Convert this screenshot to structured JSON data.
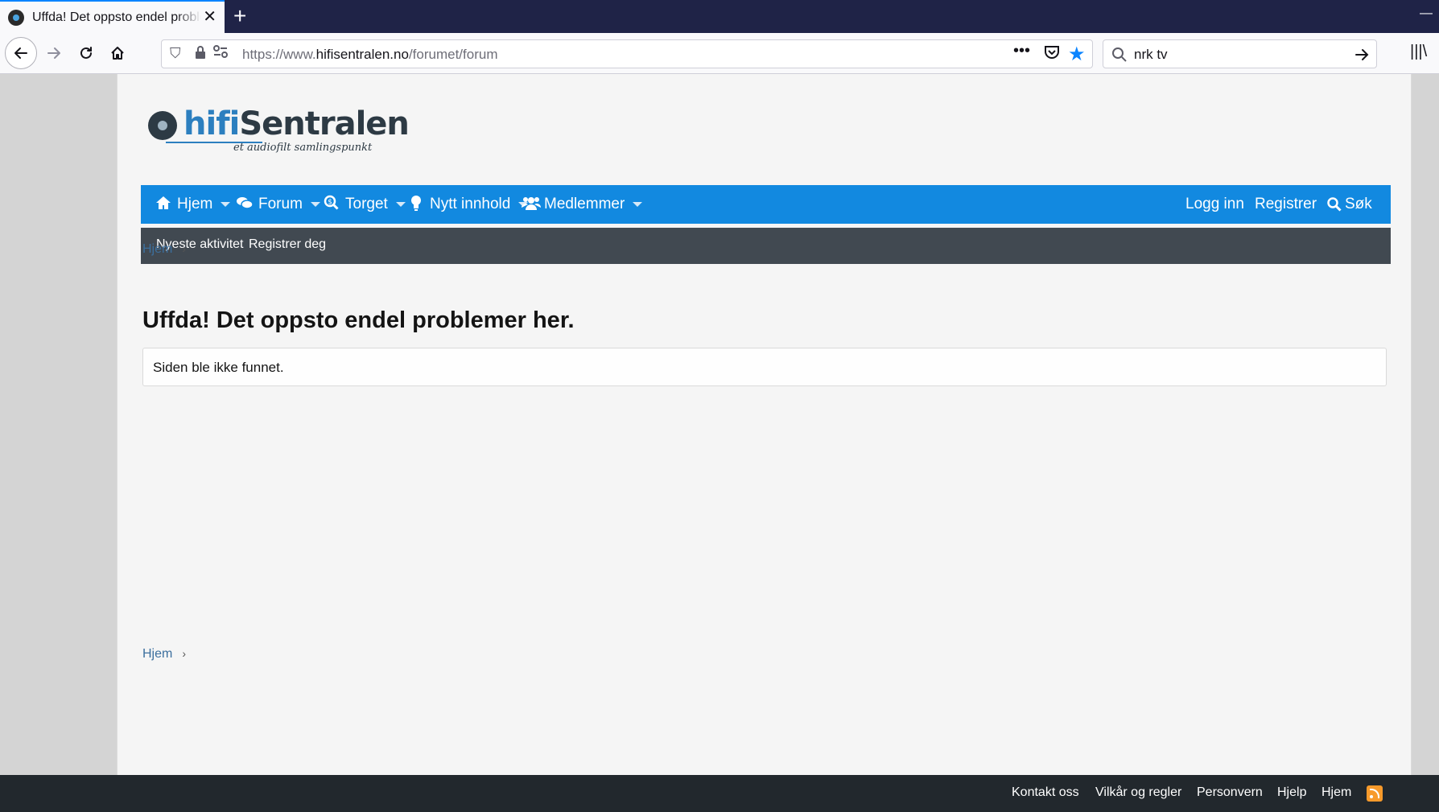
{
  "browser": {
    "tab_title": "Uffda! Det oppsto endel problemer her.",
    "new_tab": "+",
    "url_prefix": "https://www.",
    "url_host": "hifisentralen.no",
    "url_path": "/forumet/forum",
    "search_value": "nrk tv"
  },
  "logo": {
    "word_part1": "hifi",
    "word_part2": "Sentralen",
    "tagline": "et audiofilt samlingspunkt"
  },
  "main_nav": {
    "items": [
      {
        "label": "Hjem",
        "icon": "home-icon"
      },
      {
        "label": "Forum",
        "icon": "comments-icon"
      },
      {
        "label": "Torget",
        "icon": "dollar-search-icon"
      },
      {
        "label": "Nytt innhold",
        "icon": "lightbulb-icon"
      },
      {
        "label": "Medlemmer",
        "icon": "users-icon"
      }
    ],
    "login": "Logg inn",
    "register": "Registrer",
    "search": "Søk"
  },
  "sub_nav": {
    "latest_activity": "Nyeste aktivitet",
    "register": "Registrer deg"
  },
  "breadcrumb": {
    "home": "Hjem"
  },
  "main": {
    "title": "Uffda! Det oppsto endel problemer her.",
    "notice": "Siden ble ikke funnet."
  },
  "footer": {
    "links": [
      "Kontakt oss",
      "Vilkår og regler",
      "Personvern",
      "Hjelp",
      "Hjem"
    ]
  },
  "colors": {
    "nav_blue": "#1289e0",
    "subnav_gray": "#414951",
    "footer_dark": "#22282d",
    "rss_orange": "#f79a2b"
  }
}
